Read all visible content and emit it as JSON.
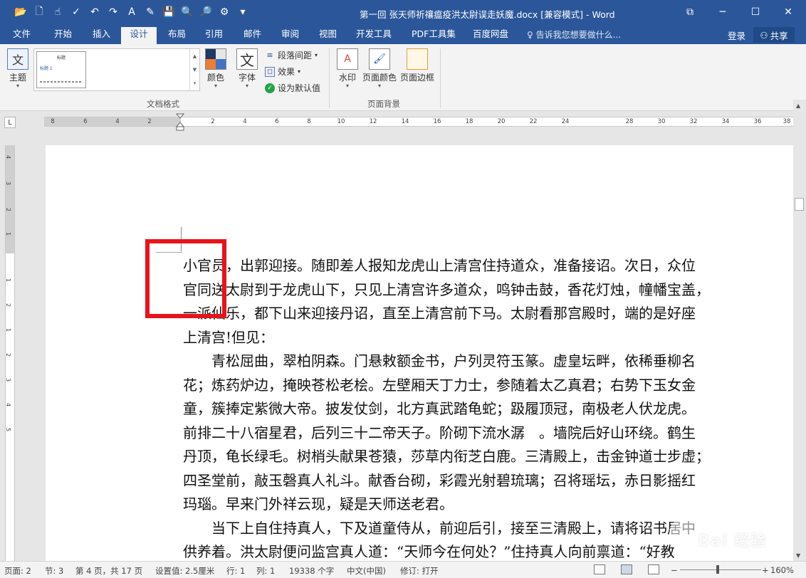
{
  "window": {
    "title": "第一回 张天师祈禳瘟疫洪太尉误走妖魔.docx [兼容模式] - Word",
    "minimize": "─",
    "maximize": "☐",
    "close": "✕",
    "restore_ribbon": "⧉"
  },
  "quick_access": {
    "icons": [
      "open-folder-icon",
      "new-doc-icon",
      "touch-mode-icon",
      "spelling-icon",
      "undo-icon",
      "redo-icon",
      "format-icon",
      "edit-icon",
      "save-icon",
      "find-icon",
      "print-preview-icon",
      "share-web-icon",
      "customize-icon"
    ],
    "glyphs": [
      "📂",
      "🗋",
      "☝",
      "✓",
      "↶",
      "↷",
      "A",
      "✎",
      "💾",
      "🔍",
      "🔎",
      "⚙",
      "▾"
    ]
  },
  "tabs": [
    "文件",
    "开始",
    "插入",
    "设计",
    "布局",
    "引用",
    "邮件",
    "审阅",
    "视图",
    "开发工具",
    "PDF工具集",
    "百度网盘"
  ],
  "active_tab": "设计",
  "tell_me": "♀ 告诉我您想要做什么...",
  "login": "登录",
  "share": "共享",
  "ribbon": {
    "theme_label": "主题",
    "theme_glyph": "文",
    "gallery_thumb_title": "标题",
    "gallery_thumb_heading": "标题 1",
    "colors_label": "颜色",
    "fonts_label": "字体",
    "fonts_glyph": "文",
    "para_spacing": "段落间距",
    "effects": "效果",
    "set_default": "设为默认值",
    "group_document_format": "文档格式",
    "watermark_label": "水印",
    "page_color_label": "页面颜色",
    "page_border_label": "页面边框",
    "group_page_background": "页面背景"
  },
  "ruler": {
    "corner": "L",
    "ticks": [
      "8",
      "6",
      "4",
      "2",
      "",
      "2",
      "4",
      "6",
      "8",
      "10",
      "12",
      "14",
      "16",
      "18",
      "20",
      "22",
      "24",
      "",
      "28",
      "30",
      "32",
      "34",
      "36",
      "38"
    ],
    "vticks": [
      "4",
      "3",
      "2",
      "1",
      "",
      "1",
      "2",
      "1",
      "2",
      "3",
      "4",
      "5"
    ]
  },
  "document": {
    "paragraphs": [
      {
        "lines": [
          "小官员，出郭迎接。随即差人报知龙虎山上清宫住持道众，准备接诏。次日，众位",
          "官同送太尉到于龙虎山下，只见上清宫许多道众，鸣钟击鼓，香花灯烛，幢幡宝盖，",
          "一派仙乐，都下山来迎接丹诏，直至上清宫前下马。太尉看那宫殿时，端的是好座",
          "上清宫!但见："
        ]
      },
      {
        "lines": [
          "　　青松屈曲，翠柏阴森。门悬敕额金书，户列灵符玉篆。虚皇坛畔，依稀垂柳名",
          "花；炼药炉边，掩映苍松老桧。左壁厢天丁力士，参随着太乙真君；右势下玉女金",
          "童，簇捧定紫微大帝。披发仗剑，北方真武踏龟蛇；趿履顶冠，南极老人伏龙虎。",
          "前排二十八宿星君，后列三十二帝天子。阶砌下流水潺　。墙院后好山环绕。鹤生",
          "丹顶，龟长绿毛。树梢头献果苍猿，莎草内衔芝白鹿。三清殿上，击金钟道士步虚；",
          "四圣堂前，敲玉磬真人礼斗。献香台砌，彩霞光射碧琉璃；召将瑶坛，赤日影摇红",
          "玛瑙。早来门外祥云现，疑是天师送老君。"
        ]
      },
      {
        "lines": [
          "　　当下上自住持真人，下及道童侍从，前迎后引，接至三清殿上，请将诏书居中",
          "供养着。洪太尉便问监宫真人道：“天师今在何处？”住持真人向前禀道：“好教"
        ]
      }
    ]
  },
  "statusbar": {
    "page": "页面: 2",
    "section": "节: 3",
    "page_of": "第 4 页，共 17 页",
    "position": "设置值: 2.5厘米",
    "line": "行: 1",
    "column": "列: 1",
    "words": "19338 个字",
    "language": "中文(中国)",
    "track": "修订: 打开",
    "zoom_minus": "−",
    "zoom_plus": "+",
    "zoom": "160%",
    "zoom_level_percent": 160
  },
  "watermark_text": "Bai 经验"
}
